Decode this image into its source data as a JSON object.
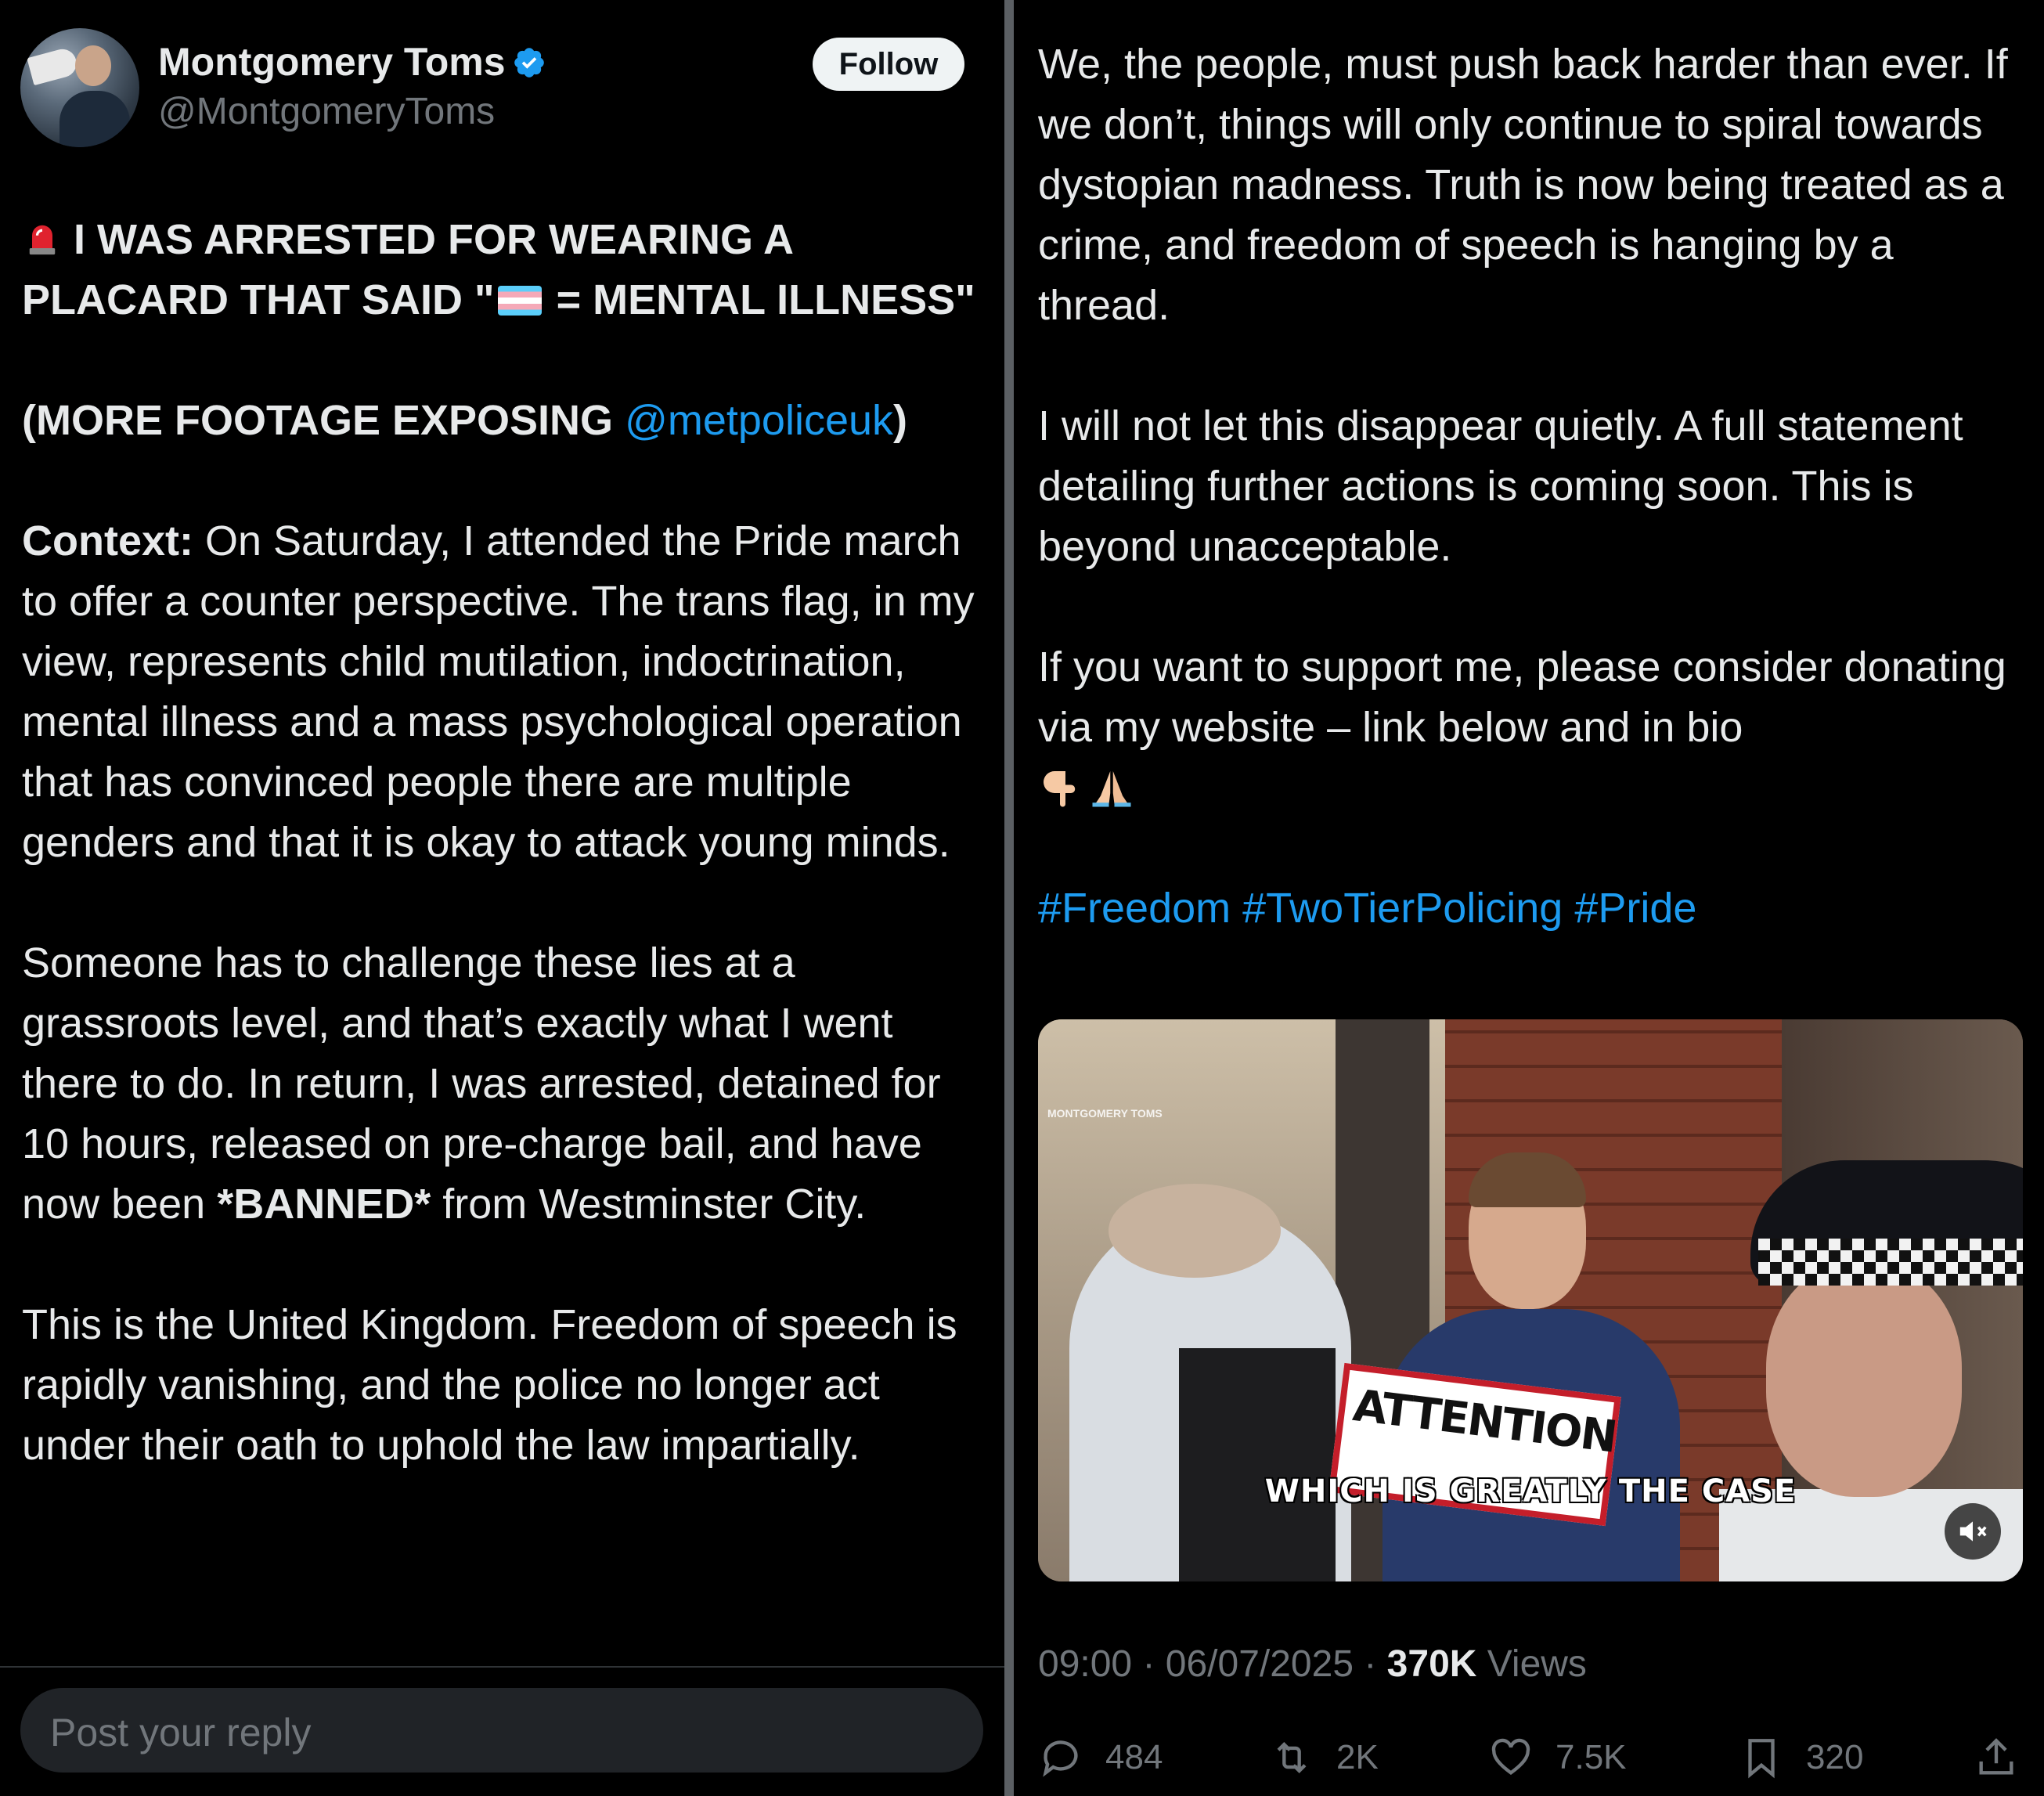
{
  "author": {
    "name": "Montgomery Toms",
    "handle": "@MontgomeryToms",
    "follow_label": "Follow"
  },
  "tweet": {
    "headline": "I WAS ARRESTED FOR WEARING A PLACARD THAT SAID \"",
    "headline_after": " = MENTAL ILLNESS\"",
    "more_footage_open": "(MORE FOOTAGE EXPOSING ",
    "mention": "@metpoliceuk",
    "more_footage_close": ")",
    "context_label": "Context:",
    "context_body": " On Saturday, I attended the Pride march to offer a counter perspective. The trans flag, in my view, represents child mutilation, indoctrination, mental illness and a mass psychological operation that has convinced people there are multiple genders and that it is okay to attack young minds.",
    "para2_a": "Someone has to challenge these lies at a grassroots level, and that’s exactly what I went there to do. In return, I was arrested, detained for 10 hours, released on pre-charge bail, and have now been ",
    "para2_banned": "*BANNED*",
    "para2_b": " from Westminster City.",
    "para3": "This is the United Kingdom. Freedom of speech is rapidly vanishing, and the police no longer act under their oath to uphold the law impartially.",
    "para4": "We, the people, must push back harder than ever. If we don’t, things will only continue to spiral towards dystopian madness. Truth is now being treated as a crime, and freedom of speech is hanging by a thread.",
    "para5": "I will not let this disappear quietly. A full statement detailing further actions is coming soon. This is beyond unacceptable.",
    "para6": "If you want to support me, please consider donating via my website – link below and in bio",
    "hashtags": [
      "#Freedom",
      "#TwoTierPolicing",
      "#Pride"
    ],
    "emojis": [
      "siren",
      "transgender-flag",
      "pointing-down",
      "folded-hands"
    ]
  },
  "video": {
    "caption": "WHICH IS GREATLY THE CASE",
    "sign_text": "ATTENTION",
    "watermark": "MONTGOMERY TOMS",
    "muted": true
  },
  "meta": {
    "time": "09:00",
    "separator": " · ",
    "date": "06/07/2025",
    "views_count": "370K",
    "views_label": " Views"
  },
  "actions": {
    "replies": "484",
    "reposts": "2K",
    "likes": "7.5K",
    "bookmarks": "320"
  },
  "reply_box": {
    "placeholder": "Post your reply"
  },
  "colors": {
    "background": "#000000",
    "text": "#e7e9ea",
    "muted": "#71767b",
    "link": "#1d9bf0",
    "follow_bg": "#eff3f4",
    "divider": "#5b5f63"
  }
}
